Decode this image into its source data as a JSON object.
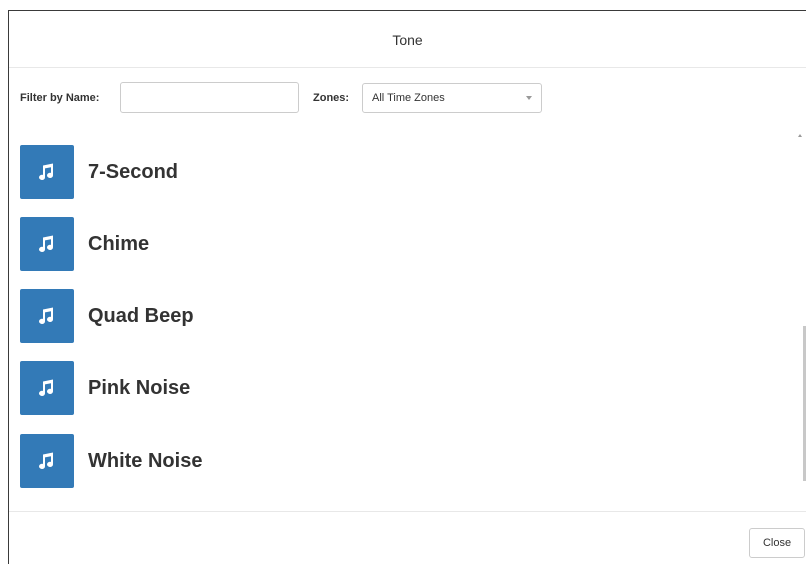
{
  "dialog": {
    "title": "Tone"
  },
  "filter": {
    "name_label": "Filter by Name:",
    "name_value": "",
    "name_placeholder": "",
    "zones_label": "Zones:",
    "zones_selected": "All Time Zones"
  },
  "tones": [
    {
      "name": "7-Second",
      "icon": "music-note-icon"
    },
    {
      "name": "Chime",
      "icon": "music-note-icon"
    },
    {
      "name": "Quad Beep",
      "icon": "music-note-icon"
    },
    {
      "name": "Pink Noise",
      "icon": "music-note-icon"
    },
    {
      "name": "White Noise",
      "icon": "music-note-icon"
    }
  ],
  "footer": {
    "close_label": "Close"
  },
  "colors": {
    "accent": "#337ab7",
    "text": "#333333",
    "border": "#cccccc"
  }
}
